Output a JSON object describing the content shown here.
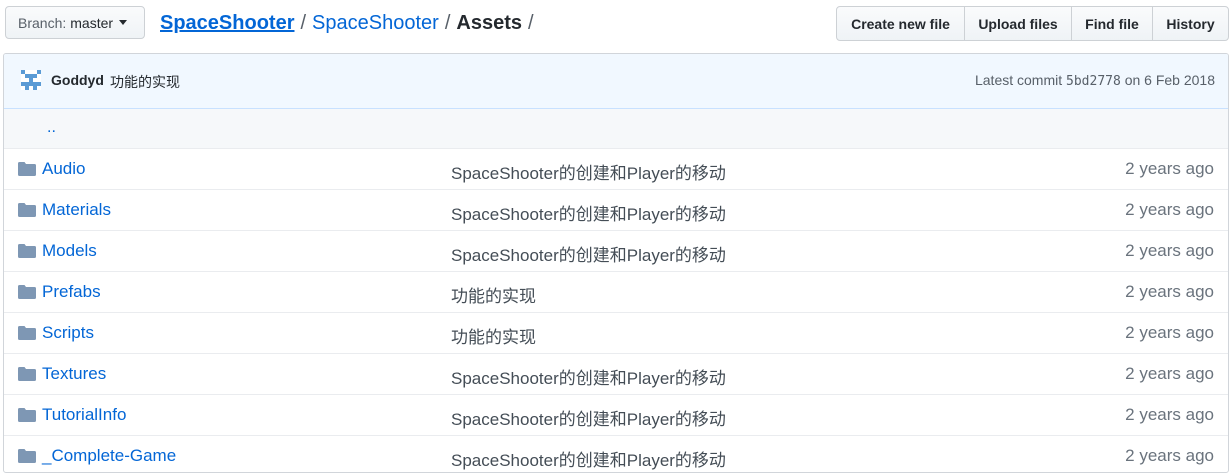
{
  "branch": {
    "label": "Branch:",
    "value": "master"
  },
  "breadcrumb": {
    "root": "SpaceShooter",
    "sub": "SpaceShooter",
    "current": "Assets",
    "sep": "/"
  },
  "actions": {
    "create_new_file": "Create new file",
    "upload_files": "Upload files",
    "find_file": "Find file",
    "history": "History"
  },
  "commit": {
    "author": "Goddyd",
    "message": "功能的实现",
    "latest_label": "Latest commit",
    "sha": "5bd2778",
    "date": "on 6 Feb 2018"
  },
  "up_link": "..",
  "files": [
    {
      "name": "Audio",
      "message": "SpaceShooter的创建和Player的移动",
      "age": "2 years ago"
    },
    {
      "name": "Materials",
      "message": "SpaceShooter的创建和Player的移动",
      "age": "2 years ago"
    },
    {
      "name": "Models",
      "message": "SpaceShooter的创建和Player的移动",
      "age": "2 years ago"
    },
    {
      "name": "Prefabs",
      "message": "功能的实现",
      "age": "2 years ago"
    },
    {
      "name": "Scripts",
      "message": "功能的实现",
      "age": "2 years ago"
    },
    {
      "name": "Textures",
      "message": "SpaceShooter的创建和Player的移动",
      "age": "2 years ago"
    },
    {
      "name": "TutorialInfo",
      "message": "SpaceShooter的创建和Player的移动",
      "age": "2 years ago"
    },
    {
      "name": "_Complete-Game",
      "message": "SpaceShooter的创建和Player的移动",
      "age": "2 years ago"
    }
  ],
  "colors": {
    "link": "#0366d6",
    "commit_bar_bg": "#f1f8ff",
    "folder_icon": "#79b8ff"
  }
}
